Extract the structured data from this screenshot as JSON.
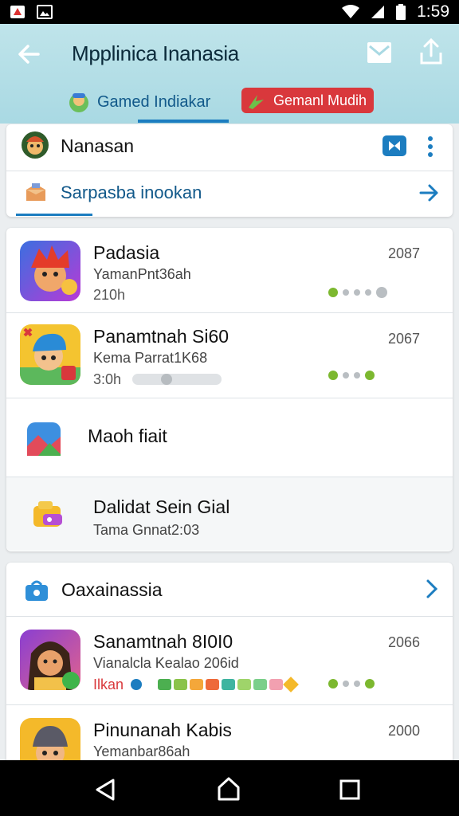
{
  "status_bar": {
    "time": "1:59"
  },
  "header": {
    "title": "Mpplinica Inanasia",
    "tabs": [
      {
        "label": "Gamed Indiakar"
      },
      {
        "label": "Gemanl Mudih"
      }
    ]
  },
  "section1": {
    "header_label": "Nanasan",
    "link_label": "Sarpasba inookan"
  },
  "list1": [
    {
      "title": "Padasia",
      "subtitle": "YamanPnt36ah",
      "meta": "210h",
      "value": "2087"
    },
    {
      "title": "Panamtnah Si60",
      "subtitle": "Kema Parrat1K68",
      "meta": "3:0h",
      "value": "2067"
    },
    {
      "title": "Maoh fiait"
    },
    {
      "title": "Dalidat Sein Gial",
      "subtitle": "Tama Gnnat2:03"
    }
  ],
  "section2": {
    "header_label": "Oaxainassia"
  },
  "list2": [
    {
      "title": "Sanamtnah 8I0I0",
      "subtitle": "Vianalcla Kealao 206id",
      "meta": "Ilkan",
      "value": "2066"
    },
    {
      "title": "Pinunanah Kabis",
      "subtitle": "Yemanbar86ah",
      "value": "2000"
    }
  ],
  "colors": {
    "accent": "#1c7dc0",
    "header_bg": "#bfe4ea",
    "tab_active_bg": "#d9383c",
    "status_green": "#7cb82f"
  },
  "icons": [
    "back-arrow-icon",
    "mail-icon",
    "share-icon",
    "more-icon",
    "arrow-right-icon",
    "chevron-right-icon"
  ]
}
